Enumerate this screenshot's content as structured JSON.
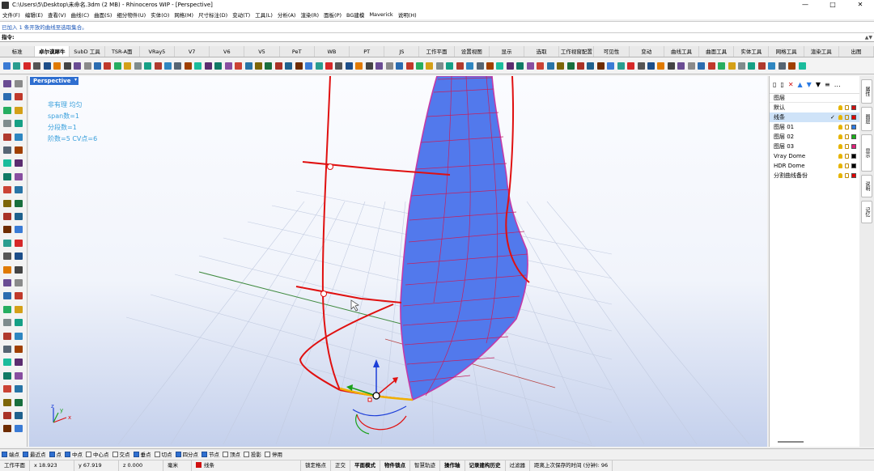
{
  "window": {
    "title": "C:\\Users\\5\\Desktop\\未命名.3dm (2 MB) - Rhinoceros WIP - [Perspective]",
    "controls": [
      "—",
      "□",
      "✕"
    ]
  },
  "menu": [
    "文件(F)",
    "编辑(E)",
    "查看(V)",
    "曲线(C)",
    "曲面(S)",
    "细分物件(U)",
    "实体(O)",
    "网格(M)",
    "尺寸标注(D)",
    "变动(T)",
    "工具(L)",
    "分析(A)",
    "渲染(R)",
    "面板(P)",
    "BG建模",
    "Maverick",
    "说明(H)"
  ],
  "command": {
    "history": "已加入 1 条开放的曲线至选取集合。",
    "prompt_label": "指令:",
    "value": "",
    "scroll_up": "▲",
    "scroll_down": "▼"
  },
  "tabs": [
    {
      "label": "标准",
      "active": false
    },
    {
      "label": "卓尔谟犀牛",
      "active": true
    },
    {
      "label": "SubD 工具",
      "active": false
    },
    {
      "label": "TSR-A面",
      "active": false
    },
    {
      "label": "VRay5",
      "active": false
    },
    {
      "label": "V7",
      "active": false
    },
    {
      "label": "V6",
      "active": false
    },
    {
      "label": "V5",
      "active": false
    },
    {
      "label": "PeT",
      "active": false
    },
    {
      "label": "WB",
      "active": false
    },
    {
      "label": "PT",
      "active": false
    },
    {
      "label": "JS",
      "active": false
    },
    {
      "label": "工作平面",
      "active": false
    },
    {
      "label": "设置视图",
      "active": false
    },
    {
      "label": "显示",
      "active": false
    },
    {
      "label": "选取",
      "active": false
    },
    {
      "label": "工作视窗配置",
      "active": false
    },
    {
      "label": "可见性",
      "active": false
    },
    {
      "label": "变动",
      "active": false
    },
    {
      "label": "曲线工具",
      "active": false
    },
    {
      "label": "曲面工具",
      "active": false
    },
    {
      "label": "实体工具",
      "active": false
    },
    {
      "label": "网格工具",
      "active": false
    },
    {
      "label": "渲染工具",
      "active": false
    },
    {
      "label": "出图",
      "active": false
    }
  ],
  "toolbar_colors": [
    "#3a7bd5",
    "#2a9d8f",
    "#d62828",
    "#555555",
    "#1d4e89",
    "#e07a00",
    "#444444",
    "#6a4c93",
    "#8a8a8a",
    "#2b6cb0",
    "#c0392b",
    "#27ae60",
    "#d4a017",
    "#7f8c8d",
    "#16a085",
    "#b03a2e",
    "#2e86c1",
    "#566573",
    "#a04000",
    "#1abc9c",
    "#5b2c6f",
    "#117a65",
    "#884ea0",
    "#cb4335",
    "#2874a6",
    "#7d6608",
    "#196f3d",
    "#a93226",
    "#1f618d",
    "#6e2c00"
  ],
  "viewport": {
    "name": "Perspective",
    "dropdown": "▾",
    "info": [
      "非有理  均匀",
      "span数=1",
      "分段数=1",
      "阶数=5 CV点=6"
    ],
    "axis_labels": {
      "x": "x",
      "y": "y",
      "z": "z"
    }
  },
  "layers_panel": {
    "tools": [
      "▯",
      "▯",
      "✕",
      "▲",
      "▼",
      "▼",
      "≡",
      "…"
    ],
    "header": "图层",
    "layers": [
      {
        "name": "默认",
        "color": "#000000",
        "selected": false,
        "current": false
      },
      {
        "name": "线条",
        "color": "#e00000",
        "selected": true,
        "current": true
      },
      {
        "name": "图层 01",
        "color": "#2a7ae4",
        "selected": false,
        "current": false
      },
      {
        "name": "图层 02",
        "color": "#18b018",
        "selected": false,
        "current": false
      },
      {
        "name": "图层 03",
        "color": "#e0207a",
        "selected": false,
        "current": false
      },
      {
        "name": "Vray Dome",
        "color": "#000000",
        "selected": false,
        "current": false
      },
      {
        "name": "HDR Dome",
        "color": "#000000",
        "selected": false,
        "current": false
      },
      {
        "name": "分割曲线备份",
        "color": "#e00000",
        "selected": false,
        "current": false
      }
    ],
    "current_mark": "✓"
  },
  "side_tabs": [
    "属性",
    "图层",
    "显示",
    "说明",
    "记忆"
  ],
  "osnap": [
    {
      "label": "端点",
      "on": true
    },
    {
      "label": "最近点",
      "on": true
    },
    {
      "label": "点",
      "on": true
    },
    {
      "label": "中点",
      "on": true
    },
    {
      "label": "中心点",
      "on": false
    },
    {
      "label": "交点",
      "on": false
    },
    {
      "label": "垂点",
      "on": true
    },
    {
      "label": "切点",
      "on": false
    },
    {
      "label": "四分点",
      "on": true
    },
    {
      "label": "节点",
      "on": true
    },
    {
      "label": "顶点",
      "on": false
    },
    {
      "label": "投影",
      "on": false
    },
    {
      "label": "停用",
      "on": false
    }
  ],
  "status": {
    "cplane": "工作平面",
    "x": "x 18.923",
    "y": "y 67.919",
    "z": "z 0.000",
    "units": "毫米",
    "layer": "线条",
    "layer_color": "#d01010",
    "toggles": [
      "锁定格点",
      "正交",
      "平面模式",
      "物件锁点",
      "智慧轨迹",
      "操作轴",
      "记录建构历史",
      "过滤器"
    ],
    "bold_toggles": [
      "平面模式",
      "物件锁点",
      "操作轴",
      "记录建构历史"
    ],
    "autosave": "距离上次保存的时间 (分钟): 96"
  }
}
